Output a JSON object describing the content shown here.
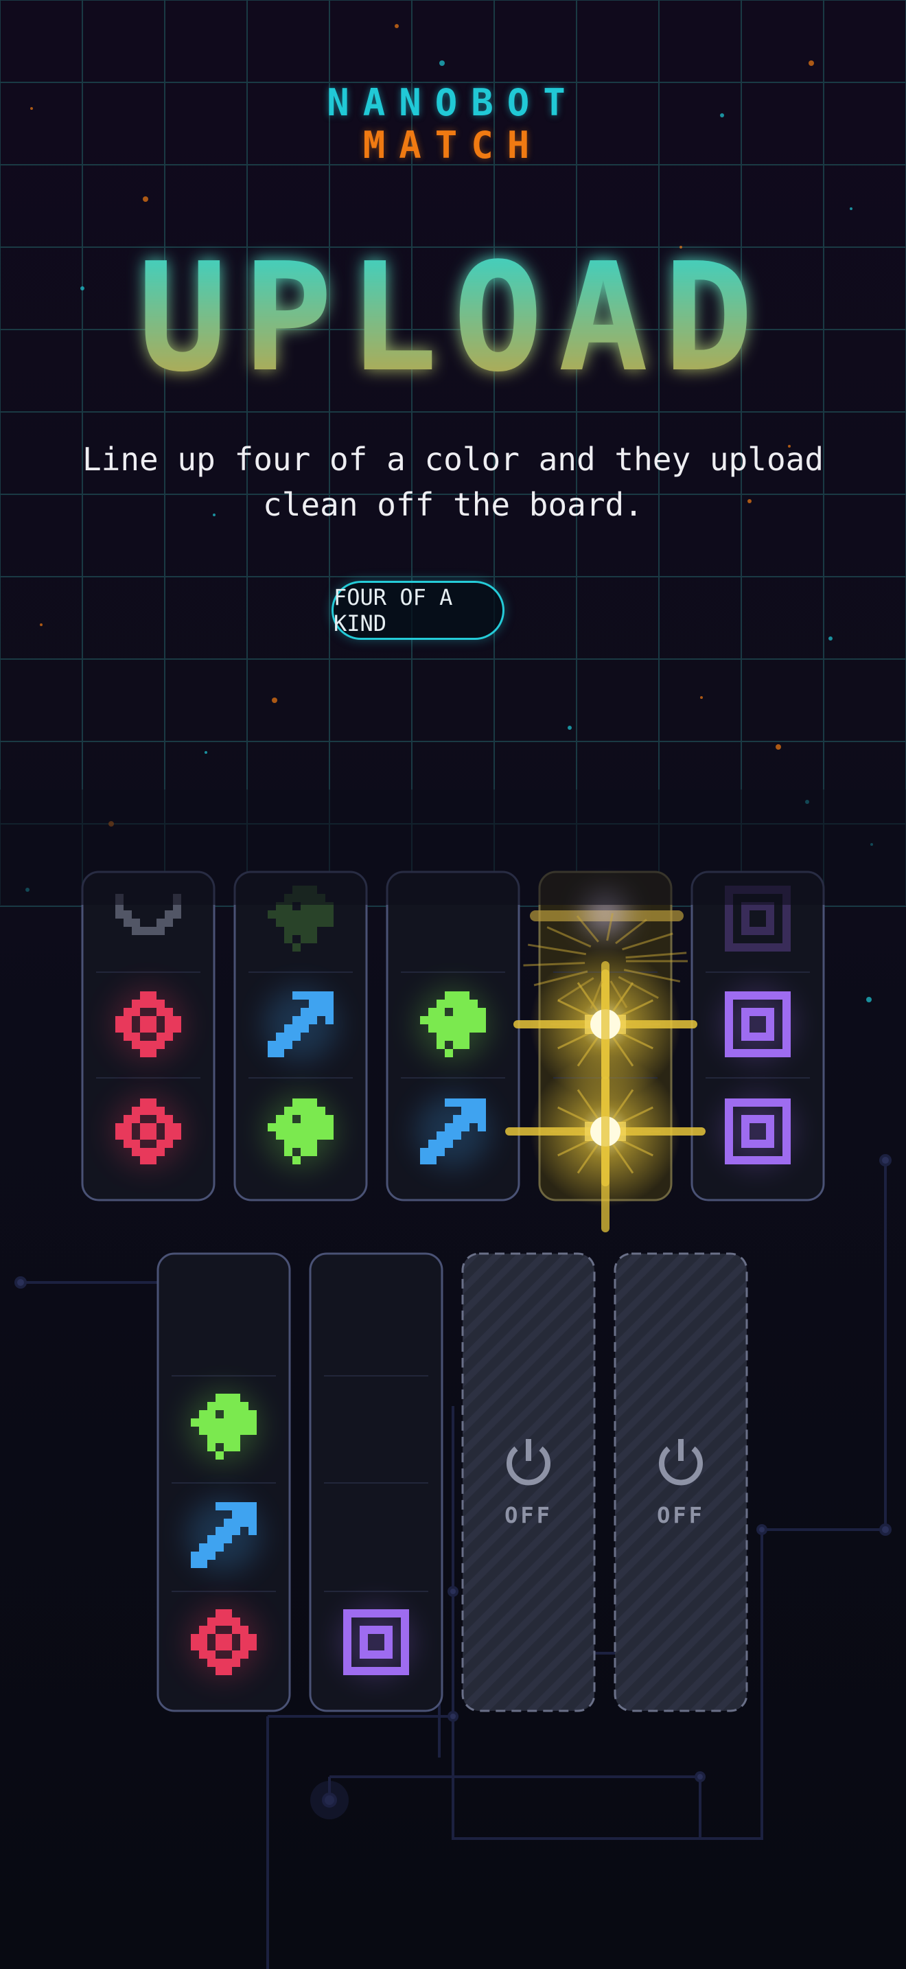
{
  "brand": {
    "line1": "NANOBOT",
    "line2": "MATCH"
  },
  "title": "UPLOAD",
  "tagline": "Line up four of a color and they upload clean off the board.",
  "badge": {
    "label": "FOUR OF A KIND"
  },
  "colors": {
    "cyan": "#21c9d6",
    "orange": "#f07a12",
    "red": "#e8395b",
    "green": "#7be94f",
    "blue": "#3fa3f0",
    "purple": "#9e6cf0",
    "yellow": "#f0d54a",
    "panel": "#4a5275"
  },
  "board": {
    "top_row": [
      {
        "tiles": [
          "dim-heart",
          "red-chip",
          "red-chip"
        ]
      },
      {
        "tiles": [
          "dim-green",
          "blue-arrow",
          "green-bot"
        ]
      },
      {
        "tiles": [
          "empty",
          "green-bot",
          "blue-arrow"
        ]
      },
      {
        "tiles": [
          "burst",
          "burst",
          "burst"
        ],
        "state": "uploading"
      },
      {
        "tiles": [
          "dim-purple",
          "purple-square",
          "purple-square"
        ]
      }
    ],
    "bottom_row": [
      {
        "tiles": [
          "empty",
          "green-bot",
          "blue-arrow",
          "red-chip"
        ]
      },
      {
        "tiles": [
          "empty",
          "empty",
          "empty",
          "purple-square"
        ]
      },
      {
        "state": "off",
        "label": "OFF",
        "icon": "power-icon"
      },
      {
        "state": "off",
        "label": "OFF",
        "icon": "power-icon"
      }
    ]
  }
}
